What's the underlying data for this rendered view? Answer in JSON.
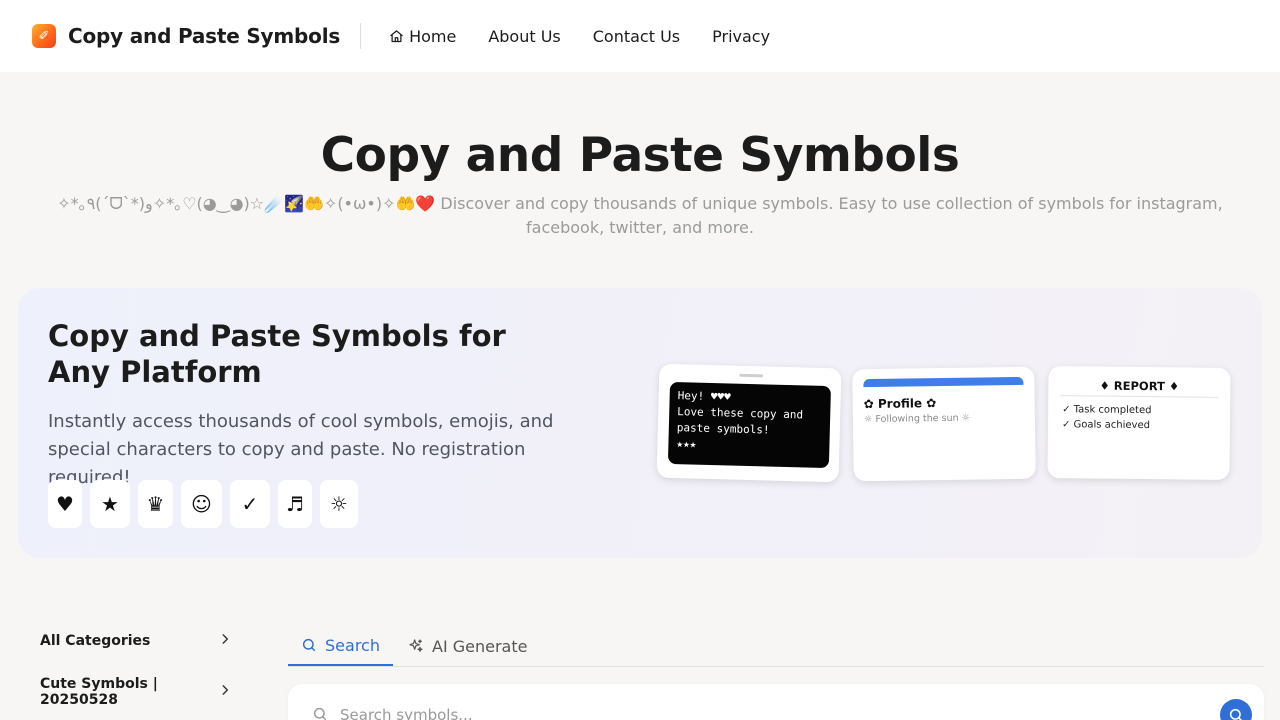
{
  "header": {
    "logo_glyph": "✐",
    "brand": "Copy and Paste Symbols",
    "nav": [
      {
        "label": "Home",
        "icon": "home-icon"
      },
      {
        "label": "About Us"
      },
      {
        "label": "Contact Us"
      },
      {
        "label": "Privacy"
      }
    ]
  },
  "hero": {
    "title": "Copy and Paste Symbols",
    "subtitle": "✧*｡٩(ˊᗜˋ*)و✧*｡♡(◕‿◕)☆☄️🌠🤲✧(•ω•)✧🤲❤️ Discover and copy thousands of unique symbols. Easy to use collection of symbols for instagram, facebook, twitter, and more."
  },
  "promo": {
    "title": "Copy and Paste Symbols for Any Platform",
    "description": "Instantly access thousands of cool symbols, emojis, and special characters to copy and paste. No registration required!",
    "symbols": [
      "♥",
      "★",
      "♛",
      "☺",
      "✓",
      "♬",
      "☼"
    ],
    "mock_phone_text": "Hey! ♥♥♥\nLove these copy and paste symbols!\n★★★",
    "mock_profile_title": "✿ Profile ✿",
    "mock_profile_sub": "☼ Following the sun ☼",
    "mock_report_title": "♦ REPORT ♦",
    "mock_report_items": [
      "✓ Task completed",
      "✓ Goals achieved"
    ]
  },
  "sidebar": {
    "items": [
      {
        "label": "All Categories"
      },
      {
        "label": "Cute Symbols | 20250528"
      }
    ]
  },
  "tabs": [
    {
      "label": "Search",
      "icon": "search-icon",
      "active": true
    },
    {
      "label": "AI Generate",
      "icon": "sparkle-icon",
      "active": false
    }
  ],
  "search": {
    "placeholder": "Search symbols...",
    "value": ""
  },
  "colors": {
    "accent": "#2f6fd6",
    "page_bg": "#f7f6f4",
    "muted_text": "#9a9a9a"
  }
}
